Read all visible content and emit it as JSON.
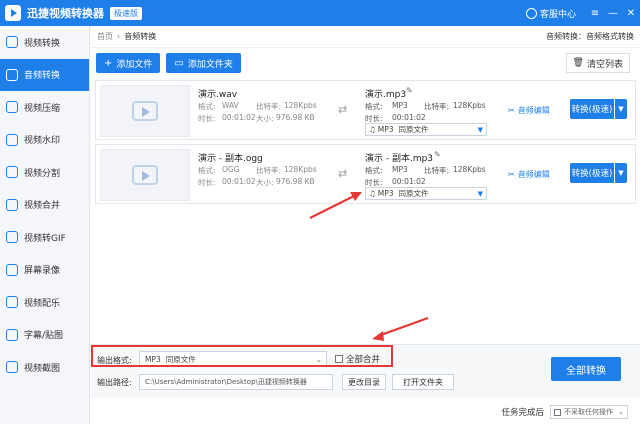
{
  "window": {
    "title": "迅捷视频转换器",
    "badge": "极速版",
    "service": "客服中心",
    "buttons": {
      "menu": "≡",
      "minimize": "—",
      "close": "✕"
    }
  },
  "sidebar": {
    "items": [
      {
        "label": "视频转换",
        "icon": "video-convert-icon"
      },
      {
        "label": "音频转换",
        "icon": "audio-convert-icon",
        "active": true
      },
      {
        "label": "视频压缩",
        "icon": "compress-icon"
      },
      {
        "label": "视频水印",
        "icon": "watermark-icon"
      },
      {
        "label": "视频分割",
        "icon": "split-icon"
      },
      {
        "label": "视频合并",
        "icon": "merge-icon"
      },
      {
        "label": "视频转GIF",
        "icon": "gif-icon"
      },
      {
        "label": "屏幕录像",
        "icon": "record-icon"
      },
      {
        "label": "视频配乐",
        "icon": "music-icon"
      },
      {
        "label": "字幕/贴图",
        "icon": "subtitle-icon"
      },
      {
        "label": "视频截图",
        "icon": "screenshot-icon"
      }
    ]
  },
  "breadcrumb": {
    "home": "首页",
    "separator": "›",
    "current": "音频转换",
    "tip": "音频转换：音频格式转换"
  },
  "toolbar": {
    "add_file": "添加文件",
    "add_folder": "添加文件夹",
    "clear": "清空列表"
  },
  "files": [
    {
      "src_name": "演示.wav",
      "format_label": "格式:",
      "format": "WAV",
      "bitrate_label": "比特率:",
      "bitrate": "128Kpbs",
      "duration_label": "时长:",
      "duration": "00:01:02",
      "size_label": "大小:",
      "size": "976.98 KB",
      "out_name": "演示.mp3",
      "out_format_label": "格式:",
      "out_format": "MP3",
      "out_bitrate_label": "比特率:",
      "out_bitrate": "128Kpbs",
      "out_duration_label": "时长:",
      "out_duration": "00:01:02",
      "select_format": "MP3",
      "select_quality": "同原文件",
      "edit": "音频编辑",
      "convert": "转换(极速)"
    },
    {
      "src_name": "演示 - 副本.ogg",
      "format_label": "格式:",
      "format": "OGG",
      "bitrate_label": "比特率:",
      "bitrate": "128Kpbs",
      "duration_label": "时长:",
      "duration": "00:01:02",
      "size_label": "大小:",
      "size": "976.98 KB",
      "out_name": "演示 - 副本.mp3",
      "out_format_label": "格式:",
      "out_format": "MP3",
      "out_bitrate_label": "比特率:",
      "out_bitrate": "128Kpbs",
      "out_duration_label": "时长:",
      "out_duration": "00:01:02",
      "select_format": "MP3",
      "select_quality": "同原文件",
      "edit": "音频编辑",
      "convert": "转换(极速)"
    }
  ],
  "output": {
    "format_label": "输出格式:",
    "format_value": "MP3",
    "format_quality": "同原文件",
    "merge_all": "全部合并",
    "path_label": "输出路径:",
    "path_value": "C:\\Users\\Administrator\\Desktop\\迅捷视频转换器",
    "change_dir": "更改目录",
    "open_folder": "打开文件夹",
    "convert_all": "全部转换"
  },
  "status": {
    "after_task_label": "任务完成后",
    "after_task_value": "不采取任何操作"
  },
  "colors": {
    "primary": "#1f7fe8",
    "highlight": "#e53935"
  }
}
